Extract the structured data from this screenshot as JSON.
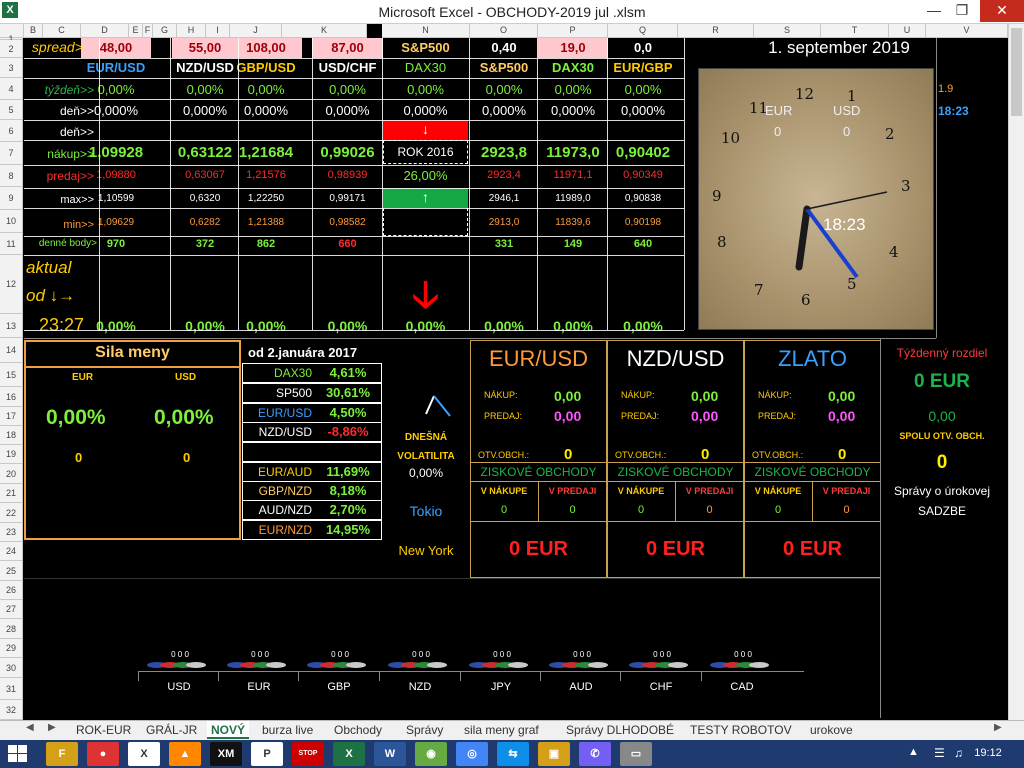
{
  "window": {
    "title": "Microsoft Excel - OBCHODY-2019 jul .xlsm"
  },
  "columns": [
    "B",
    "C",
    "D",
    "E",
    "F",
    "G",
    "H",
    "I",
    "J",
    "K",
    "N",
    "O",
    "P",
    "Q",
    "R",
    "S",
    "T",
    "U",
    "V"
  ],
  "rows": [
    "1",
    "2",
    "3",
    "4",
    "5",
    "6",
    "7",
    "8",
    "9",
    "10",
    "11",
    "12",
    "13",
    "14",
    "15",
    "16",
    "17",
    "18",
    "19",
    "20",
    "21",
    "22",
    "23",
    "24",
    "25",
    "26",
    "27",
    "28",
    "29",
    "30",
    "31",
    "32"
  ],
  "r2": {
    "label": "spread>>",
    "vals": [
      "48,00",
      "55,00",
      "108,00",
      "87,00",
      "S&P500",
      "0,40",
      "19,0",
      "0,0"
    ]
  },
  "date": "1. september 2019",
  "pairs": [
    "EUR/USD",
    "NZD/USD",
    "GBP/USD",
    "USD/CHF",
    "DAX30",
    "S&P500",
    "DAX30",
    "EUR/GBP"
  ],
  "labels": {
    "week": "týždeň>>",
    "day": "deň>>",
    "day2": "deň>>",
    "buy": "nákup>>",
    "sell": "predaj>>",
    "max": "max>>",
    "min": "min>>",
    "points": "denné body>"
  },
  "week": [
    "0,00%",
    "0,00%",
    "0,00%",
    "0,00%",
    "0,00%",
    "0,00%",
    "0,00%",
    "0,00%"
  ],
  "day": [
    "0,000%",
    "0,000%",
    "0,000%",
    "0,000%",
    "0,000%",
    "0,000%",
    "0,000%",
    "0,000%"
  ],
  "buy": [
    "1,09928",
    "0,63122",
    "1,21684",
    "0,99026",
    "2923,8",
    "11973,0",
    "0,90402"
  ],
  "sell": [
    "1,09880",
    "0,63067",
    "1,21576",
    "0,98939",
    "2923,4",
    "11971,1",
    "0,90349"
  ],
  "max": [
    "1,10599",
    "0,6320",
    "1,22250",
    "0,99171",
    "2946,1",
    "11989,0",
    "0,90838"
  ],
  "min": [
    "1,09629",
    "0,6282",
    "1,21388",
    "0,98582",
    "2913,0",
    "11839,6",
    "0,90198"
  ],
  "points": [
    "970",
    "372",
    "862",
    "660",
    "331",
    "149",
    "640"
  ],
  "rok": {
    "label": "ROK 2016",
    "pct": "26,00%",
    "down_arrow": "arrow-down-icon",
    "up_arrow": "arrow-up-icon"
  },
  "aktual": {
    "l1": "aktual",
    "l2": "od ↓→",
    "time": "23:27"
  },
  "row13": [
    "0,00%",
    "0,00%",
    "0,00%",
    "0,00%",
    "0,00%",
    "0,00%",
    "0,00%",
    "0,00%"
  ],
  "side": {
    "v1": "1.9",
    "v2": "18:23"
  },
  "clock": {
    "numbers": [
      "12",
      "1",
      "2",
      "3",
      "4",
      "5",
      "6",
      "7",
      "8",
      "9",
      "10",
      "11"
    ],
    "l_eur": "EUR",
    "l_usd": "USD",
    "v_eur": "0",
    "v_usd": "0",
    "time": "18:23"
  },
  "sila": {
    "title": "Sila meny",
    "eur": "EUR",
    "usd": "USD",
    "pct_eur": "0,00%",
    "pct_usd": "0,00%",
    "n_eur": "0",
    "n_usd": "0"
  },
  "since": {
    "title": "od 2.januára 2017",
    "rows": [
      [
        "DAX30",
        "4,61%"
      ],
      [
        "SP500",
        "30,61%"
      ],
      [
        "EUR/USD",
        "4,50%"
      ],
      [
        "NZD/USD",
        "-8,86%"
      ],
      [
        "",
        ""
      ],
      [
        "EUR/AUD",
        "11,69%"
      ],
      [
        "GBP/NZD",
        "8,18%"
      ],
      [
        "AUD/NZD",
        "2,70%"
      ],
      [
        "EUR/NZD",
        "14,95%"
      ]
    ]
  },
  "vol": {
    "l1": "DNEŠNÁ",
    "l2": "VOLATILITA",
    "pct": "0,00%",
    "tokio": "Tokio",
    "ny": "New York"
  },
  "panels": [
    {
      "title": "EUR/USD",
      "buy": "0,00",
      "sell": "0,00",
      "open": "0",
      "openlbl": "OTV.OBCH.:",
      "profit": "ZISKOVÉ OBCHODY",
      "vb": "0",
      "vs": "0",
      "eur": "0 EUR"
    },
    {
      "title": "NZD/USD",
      "buy": "0,00",
      "sell": "0,00",
      "open": "0",
      "openlbl": "OTV.OBCH.:",
      "profit": "ZISKOVÉ OBCHODY",
      "vb": "0",
      "vs": "0",
      "eur": "0 EUR"
    },
    {
      "title": "ZLATO",
      "buy": "0,00",
      "sell": "0,00",
      "open": "0",
      "openlbl": "OTV.OBCH.:",
      "profit": "ZISKOVÉ OBCHODY",
      "vb": "0",
      "vs": "0",
      "eur": "0 EUR"
    }
  ],
  "panel_labels": {
    "buy": "NÁKUP:",
    "sell": "PREDAJ:",
    "vb": "V NÁKUPE",
    "vs": "V PREDAJI"
  },
  "weekly": {
    "title": "Týždenný rozdiel",
    "eur": "0 EUR",
    "val": "0,00",
    "spolu": "SPOLU OTV. OBCH.",
    "count": "0",
    "spravy": "Správy o úrokovej",
    "sadzbe": "SADZBE"
  },
  "currencies": [
    "USD",
    "EUR",
    "GBP",
    "NZD",
    "JPY",
    "AUD",
    "CHF",
    "CAD"
  ],
  "zeros": "0 0 0",
  "tabs": [
    "ROK-EUR",
    "GRÁL-JR",
    "NOVÝ",
    "burza live",
    "Obchody",
    "Správy",
    "sila meny graf",
    "Správy DLHODOBÉ",
    "TESTY ROBOTOV",
    "urokove"
  ],
  "taskbar": {
    "time": "19:12"
  }
}
